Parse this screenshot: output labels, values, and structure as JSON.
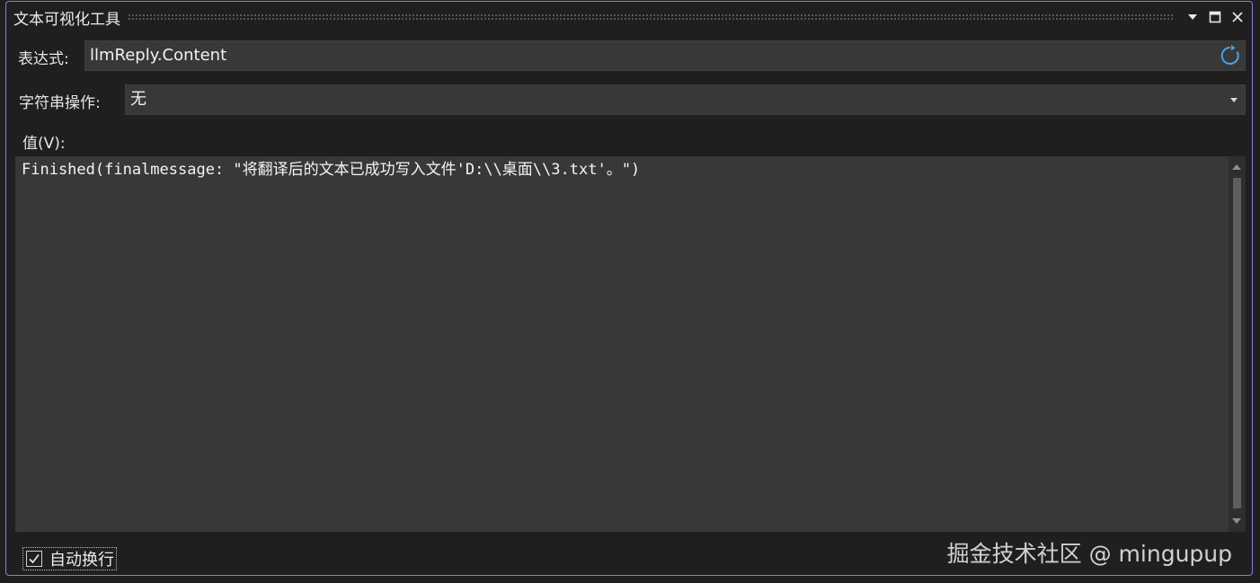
{
  "window": {
    "title": "文本可视化工具"
  },
  "titlebar_buttons": {
    "dropdown_icon": "chevron-down-icon",
    "maximize_icon": "maximize-icon",
    "close_icon": "close-icon"
  },
  "expression": {
    "label": "表达式:",
    "value": "llmReply.Content",
    "refresh_icon": "refresh-icon"
  },
  "string_operation": {
    "label": "字符串操作:",
    "selected": "无"
  },
  "value_section": {
    "label": "值(V):",
    "content": "Finished(finalmessage: \"将翻译后的文本已成功写入文件'D:\\\\桌面\\\\3.txt'。\")"
  },
  "auto_wrap": {
    "label": "自动换行",
    "checked": true
  },
  "watermark": "掘金技术社区 @ mingupup",
  "colors": {
    "window_border": "#8b7fd9",
    "background": "#1f1f1f",
    "field": "#383838",
    "refresh_accent": "#4aa3e8"
  }
}
